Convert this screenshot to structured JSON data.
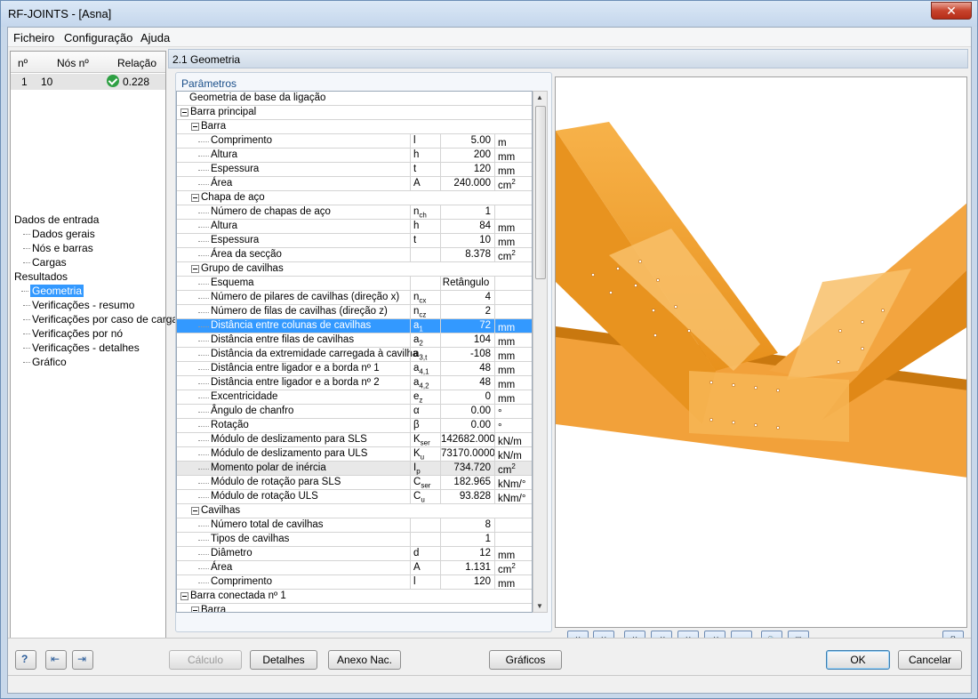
{
  "window": {
    "title": "RF-JOINTS - [Asna]",
    "close": "✕"
  },
  "menu": [
    "Ficheiro",
    "Configuração",
    "Ajuda"
  ],
  "nodes_table": {
    "headers": [
      "nº",
      "Nós nº",
      "Relação"
    ],
    "rows": [
      {
        "no": "1",
        "node": "10",
        "ratio": "0.228"
      }
    ]
  },
  "tree": {
    "input_group": "Dados de entrada",
    "input_items": [
      "Dados gerais",
      "Nós e barras",
      "Cargas"
    ],
    "results_group": "Resultados",
    "results_items": [
      "Geometria",
      "Verificações - resumo",
      "Verificações por caso de carga",
      "Verificações por nó",
      "Verificações - detalhes",
      "Gráfico"
    ],
    "selected": "Geometria"
  },
  "section_title": "2.1 Geometria",
  "params_label": "Parâmetros",
  "rows": [
    {
      "level": 0,
      "type": "header",
      "name": "Geometria de base da ligação"
    },
    {
      "level": 0,
      "type": "group",
      "name": "Barra principal"
    },
    {
      "level": 1,
      "type": "group",
      "name": "Barra"
    },
    {
      "level": 2,
      "name": "Comprimento",
      "sym": "l",
      "sub": "",
      "val": "5.00",
      "unit": "m",
      "usup": ""
    },
    {
      "level": 2,
      "name": "Altura",
      "sym": "h",
      "sub": "",
      "val": "200",
      "unit": "mm",
      "usup": ""
    },
    {
      "level": 2,
      "name": "Espessura",
      "sym": "t",
      "sub": "",
      "val": "120",
      "unit": "mm",
      "usup": ""
    },
    {
      "level": 2,
      "name": "Área",
      "sym": "A",
      "sub": "",
      "val": "240.000",
      "unit": "cm",
      "usup": "2"
    },
    {
      "level": 1,
      "type": "group",
      "name": "Chapa de aço"
    },
    {
      "level": 2,
      "name": "Número de chapas de aço",
      "sym": "n",
      "sub": "ch",
      "val": "1",
      "unit": "",
      "usup": ""
    },
    {
      "level": 2,
      "name": "Altura",
      "sym": "h",
      "sub": "",
      "val": "84",
      "unit": "mm",
      "usup": ""
    },
    {
      "level": 2,
      "name": "Espessura",
      "sym": "t",
      "sub": "",
      "val": "10",
      "unit": "mm",
      "usup": ""
    },
    {
      "level": 2,
      "name": "Área da secção",
      "sym": "",
      "sub": "",
      "val": "8.378",
      "unit": "cm",
      "usup": "2"
    },
    {
      "level": 1,
      "type": "group",
      "name": "Grupo de cavilhas"
    },
    {
      "level": 2,
      "name": "Esquema",
      "sym": "",
      "sub": "",
      "val": "Retângulo",
      "unit": "",
      "usup": "",
      "center": true
    },
    {
      "level": 2,
      "name": "Número de pilares de cavilhas (direção x)",
      "sym": "n",
      "sub": "cx",
      "val": "4",
      "unit": "",
      "usup": ""
    },
    {
      "level": 2,
      "name": "Número de filas de cavilhas (direção z)",
      "sym": "n",
      "sub": "cz",
      "val": "2",
      "unit": "",
      "usup": ""
    },
    {
      "level": 2,
      "name": "Distância entre colunas de cavilhas",
      "sym": "a",
      "sub": "1",
      "val": "72",
      "unit": "mm",
      "usup": "",
      "selected": true
    },
    {
      "level": 2,
      "name": "Distância entre filas de cavilhas",
      "sym": "a",
      "sub": "2",
      "val": "104",
      "unit": "mm",
      "usup": ""
    },
    {
      "level": 2,
      "name": "Distância da extremidade carregada à cavilha",
      "sym": "a",
      "sub": "3,t",
      "val": "-108",
      "unit": "mm",
      "usup": ""
    },
    {
      "level": 2,
      "name": "Distância entre ligador e a borda nº 1",
      "sym": "a",
      "sub": "4,1",
      "val": "48",
      "unit": "mm",
      "usup": ""
    },
    {
      "level": 2,
      "name": "Distância entre ligador e a borda nº 2",
      "sym": "a",
      "sub": "4,2",
      "val": "48",
      "unit": "mm",
      "usup": ""
    },
    {
      "level": 2,
      "name": "Excentricidade",
      "sym": "e",
      "sub": "z",
      "val": "0",
      "unit": "mm",
      "usup": ""
    },
    {
      "level": 2,
      "name": "Ângulo de chanfro",
      "sym": "α",
      "sub": "",
      "val": "0.00",
      "unit": "°",
      "usup": ""
    },
    {
      "level": 2,
      "name": "Rotação",
      "sym": "β",
      "sub": "",
      "val": "0.00",
      "unit": "°",
      "usup": ""
    },
    {
      "level": 2,
      "name": "Módulo de deslizamento para SLS",
      "sym": "K",
      "sub": "ser",
      "val": "142682.000",
      "unit": "kN/m",
      "usup": ""
    },
    {
      "level": 2,
      "name": "Módulo de deslizamento para ULS",
      "sym": "K",
      "sub": "u",
      "val": "73170.0000",
      "unit": "kN/m",
      "usup": ""
    },
    {
      "level": 2,
      "name": "Momento polar de inércia",
      "sym": "I",
      "sub": "p",
      "val": "734.720",
      "unit": "cm",
      "usup": "2",
      "gray": true
    },
    {
      "level": 2,
      "name": "Módulo de rotação para SLS",
      "sym": "C",
      "sub": "ser",
      "val": "182.965",
      "unit": "kNm/°",
      "usup": ""
    },
    {
      "level": 2,
      "name": "Módulo de rotação ULS",
      "sym": "C",
      "sub": "u",
      "val": "93.828",
      "unit": "kNm/°",
      "usup": ""
    },
    {
      "level": 1,
      "type": "group",
      "name": "Cavilhas"
    },
    {
      "level": 2,
      "name": "Número total de cavilhas",
      "sym": "",
      "sub": "",
      "val": "8",
      "unit": "",
      "usup": ""
    },
    {
      "level": 2,
      "name": "Tipos de cavilhas",
      "sym": "",
      "sub": "",
      "val": "1",
      "unit": "",
      "usup": ""
    },
    {
      "level": 2,
      "name": "Diâmetro",
      "sym": "d",
      "sub": "",
      "val": "12",
      "unit": "mm",
      "usup": ""
    },
    {
      "level": 2,
      "name": "Área",
      "sym": "A",
      "sub": "",
      "val": "1.131",
      "unit": "cm",
      "usup": "2"
    },
    {
      "level": 2,
      "name": "Comprimento",
      "sym": "l",
      "sub": "",
      "val": "120",
      "unit": "mm",
      "usup": ""
    },
    {
      "level": 0,
      "type": "group",
      "name": "Barra conectada nº 1"
    },
    {
      "level": 1,
      "type": "group",
      "name": "Barra"
    }
  ],
  "viewport_tools": [
    "X",
    "Y",
    "X",
    "-X",
    "Y",
    "-Y",
    "▣",
    "🔍",
    "❏",
    "🖨"
  ],
  "buttons": {
    "calc": "Cálculo",
    "details": "Detalhes",
    "annex": "Anexo Nac.",
    "graphics": "Gráficos",
    "ok": "OK",
    "cancel": "Cancelar"
  },
  "colors": {
    "wood": "#f5a623",
    "wood_dark": "#d98a14",
    "selection": "#3399ff"
  }
}
